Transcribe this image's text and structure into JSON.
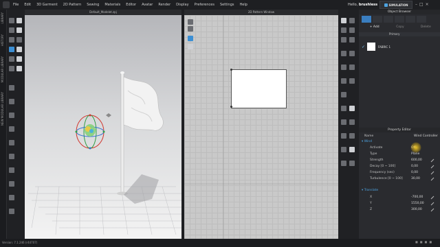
{
  "menu": [
    "File",
    "Edit",
    "3D Garment",
    "2D Pattern",
    "Sewing",
    "Materials",
    "Editor",
    "Avatar",
    "Render",
    "Display",
    "Preferences",
    "Settings",
    "Help"
  ],
  "user": {
    "greeting": "Hello,",
    "name": "brushless"
  },
  "mode_tab": "SIMULATION",
  "left_sidebar_labels": [
    "LIBRARY",
    "HISTORY",
    "MODULAR LIBRARY",
    "NEW MODULAR LIBRARY"
  ],
  "view3d": {
    "title": "Default_Modelet.zpj"
  },
  "view2d": {
    "title": "2D Pattern Window"
  },
  "object_browser": {
    "title": "Object Browser",
    "buttons": [
      "+ Add",
      "Copy",
      "Delete"
    ],
    "section": "Primary",
    "fabric": "FABRIC 1"
  },
  "property_editor": {
    "title": "Property Editor",
    "name_label": "Name",
    "name_value": "Wind Controller",
    "group_wind": "Wind",
    "rows": [
      {
        "k": "Activate",
        "v": "Off"
      },
      {
        "k": "Type",
        "v": "Plane"
      },
      {
        "k": "Strength",
        "v": "600,00"
      },
      {
        "k": "Decay [0 ~ 100]",
        "v": "0,00"
      },
      {
        "k": "Frequency (sec)",
        "v": "0,00"
      },
      {
        "k": "Turbulence [0 ~ 100]",
        "v": "30,00"
      }
    ],
    "group_translate": "Translate",
    "translate": [
      {
        "k": "X",
        "v": "-700,00"
      },
      {
        "k": "Y",
        "v": "1550,00"
      },
      {
        "k": "Z",
        "v": "300,00"
      }
    ]
  },
  "status": "Version: 7.1.246 (r44707)",
  "colors": {
    "accent": "#4da3e0",
    "bg": "#232427",
    "cursor_highlight": "#ffd228"
  }
}
